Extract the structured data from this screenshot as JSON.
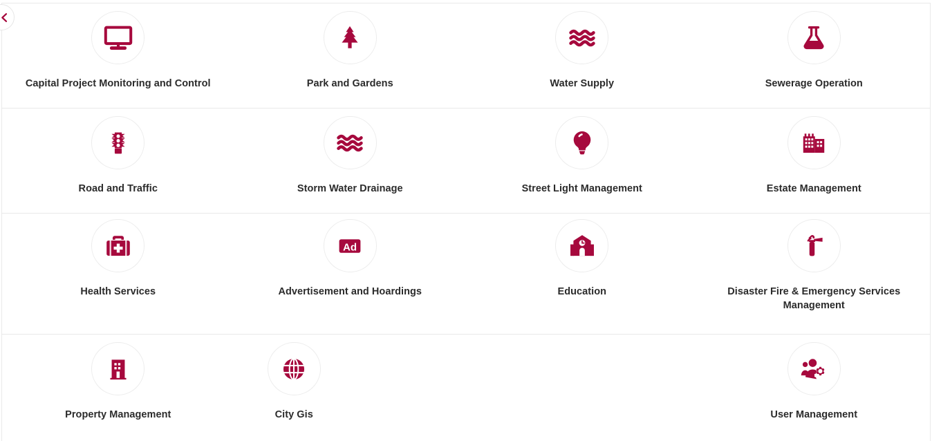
{
  "back_button": {
    "label": "Back",
    "icon": "chevron-left-icon"
  },
  "theme": {
    "accent": "#a6093d",
    "text": "#2b2b2b",
    "border": "#e9e9e9",
    "circle_border": "#ececec",
    "background": "#ffffff"
  },
  "grid": {
    "columns": 4,
    "rows": [
      {
        "tiles": [
          {
            "label": "Capital Project Monitoring and Control",
            "icon": "monitor-icon"
          },
          {
            "label": "Park and Gardens",
            "icon": "tree-icon"
          },
          {
            "label": "Water Supply",
            "icon": "water-waves-icon"
          },
          {
            "label": "Sewerage Operation",
            "icon": "flask-icon"
          }
        ]
      },
      {
        "tiles": [
          {
            "label": "Road and Traffic",
            "icon": "traffic-light-icon"
          },
          {
            "label": "Storm Water Drainage",
            "icon": "water-waves-icon"
          },
          {
            "label": "Street Light Management",
            "icon": "lightbulb-icon"
          },
          {
            "label": "Estate Management",
            "icon": "buildings-icon"
          }
        ]
      },
      {
        "tiles": [
          {
            "label": "Health Services",
            "icon": "medical-kit-icon"
          },
          {
            "label": "Advertisement and Hoardings",
            "icon": "ad-badge-icon"
          },
          {
            "label": "Education",
            "icon": "school-icon"
          },
          {
            "label": "Disaster Fire & Emergency Services Management",
            "icon": "fire-extinguisher-icon"
          }
        ]
      },
      {
        "tiles": [
          {
            "label": "Property Management",
            "icon": "building-icon"
          },
          {
            "label": "City Gis",
            "icon": "globe-icon"
          },
          {
            "label": "",
            "icon": ""
          },
          {
            "label": "User Management",
            "icon": "users-gear-icon"
          }
        ]
      }
    ]
  }
}
